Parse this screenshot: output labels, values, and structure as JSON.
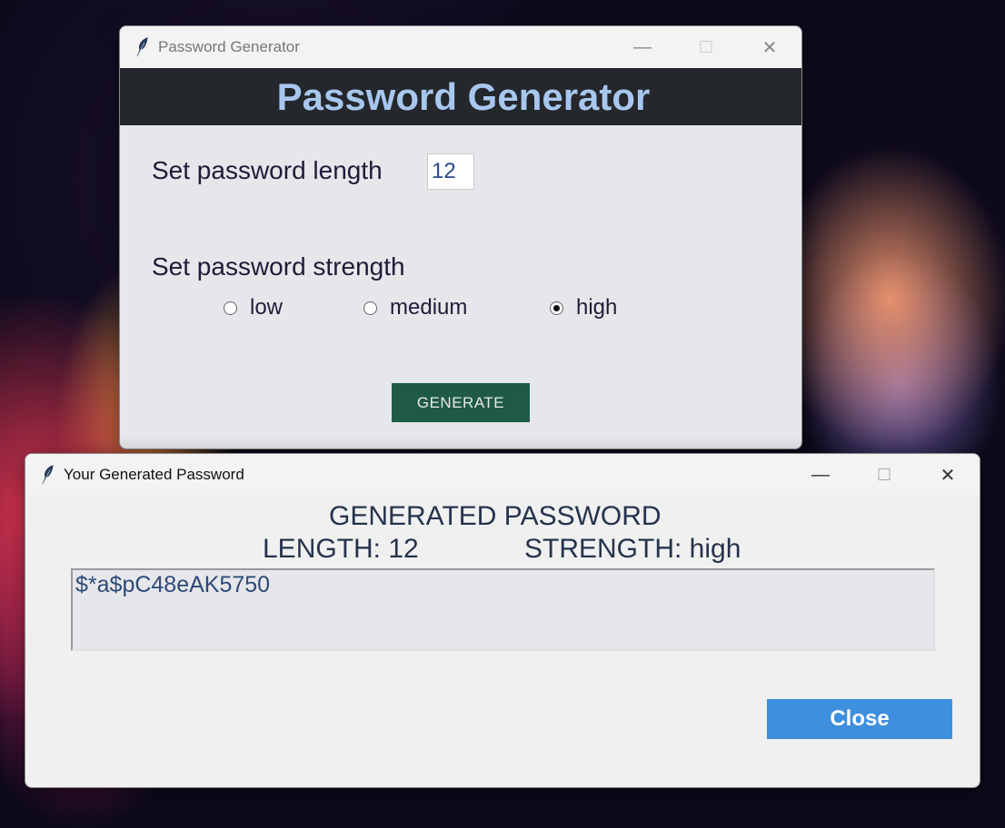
{
  "generator_window": {
    "title": "Password Generator",
    "header_title": "Password Generator",
    "length_label": "Set password length",
    "length_value": "12",
    "strength_label": "Set password strength",
    "strength_options": [
      "low",
      "medium",
      "high"
    ],
    "selected_strength": "high",
    "generate_label": "GENERATE",
    "controls": {
      "minimize": "—",
      "maximize": "☐",
      "close": "✕"
    }
  },
  "result_window": {
    "title": "Your Generated Password",
    "heading": "GENERATED PASSWORD",
    "length_text": "LENGTH: 12",
    "strength_text": "STRENGTH: high",
    "password": "$*a$pC48eAK5750",
    "close_label": "Close",
    "controls": {
      "minimize": "—",
      "maximize": "☐",
      "close": "✕"
    }
  },
  "colors": {
    "header_bg": "#24272b",
    "header_text": "#a8c7ee",
    "generate_button": "#1f5a46",
    "close_button": "#3f8fdf"
  },
  "icons": {
    "app_icon": "feather-icon"
  }
}
